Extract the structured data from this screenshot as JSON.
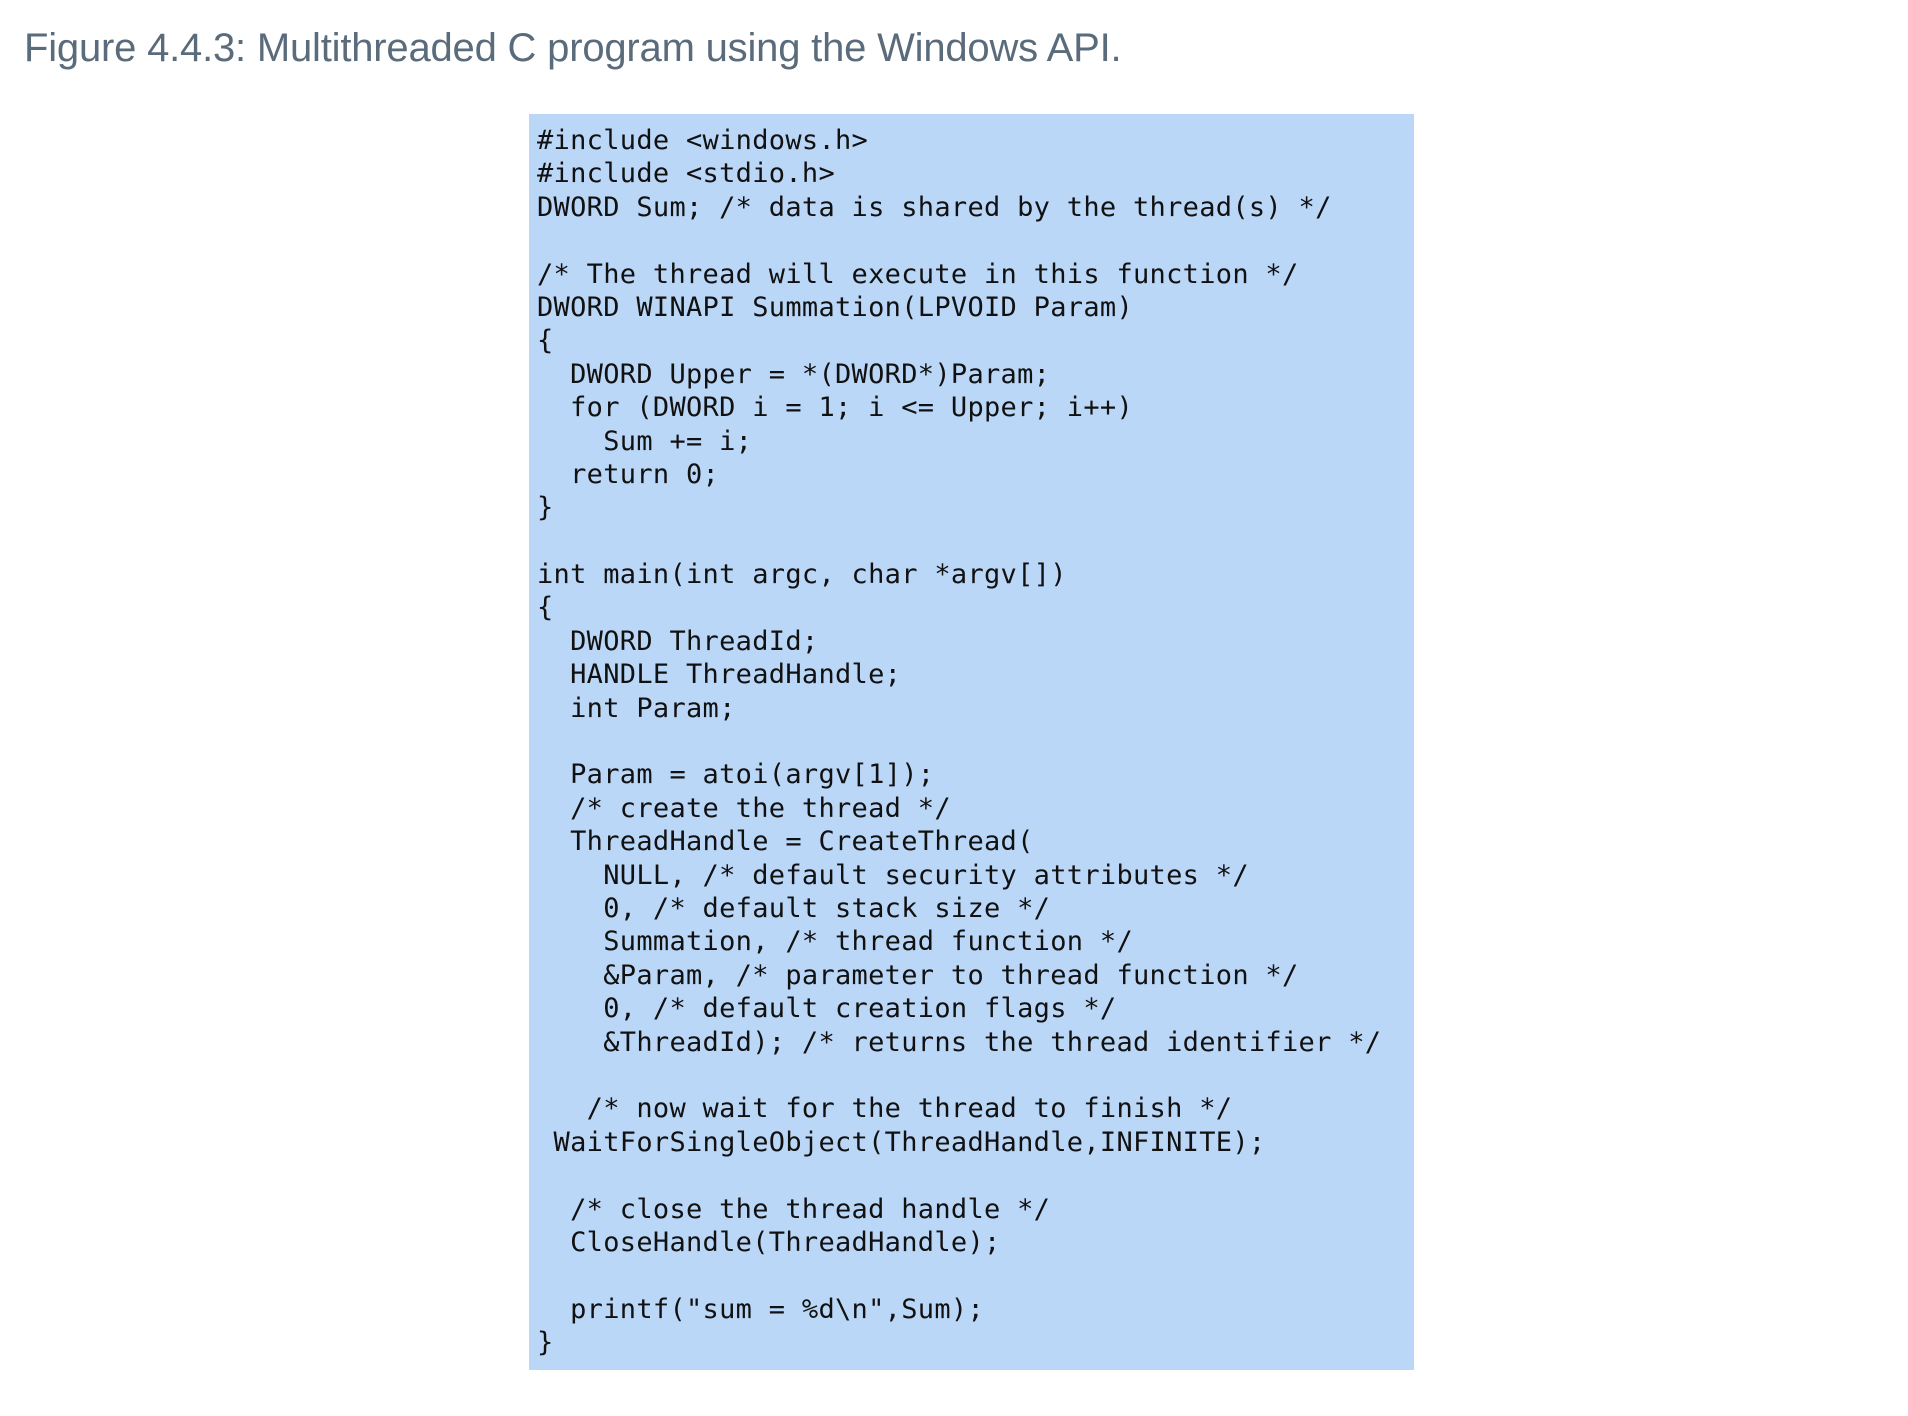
{
  "figure": {
    "caption": "Figure 4.4.3: Multithreaded C program using the Windows API."
  },
  "code": {
    "background_color": "#bbd7f8",
    "lines": [
      "#include <windows.h>",
      "#include <stdio.h>",
      "DWORD Sum; /* data is shared by the thread(s) */",
      "",
      "/* The thread will execute in this function */",
      "DWORD WINAPI Summation(LPVOID Param)",
      "{",
      "  DWORD Upper = *(DWORD*)Param;",
      "  for (DWORD i = 1; i <= Upper; i++)",
      "    Sum += i;",
      "  return 0;",
      "}",
      "",
      "int main(int argc, char *argv[])",
      "{",
      "  DWORD ThreadId;",
      "  HANDLE ThreadHandle;",
      "  int Param;",
      "",
      "  Param = atoi(argv[1]);",
      "  /* create the thread */",
      "  ThreadHandle = CreateThread(",
      "    NULL, /* default security attributes */",
      "    0, /* default stack size */",
      "    Summation, /* thread function */",
      "    &Param, /* parameter to thread function */",
      "    0, /* default creation flags */",
      "    &ThreadId); /* returns the thread identifier */",
      "",
      "   /* now wait for the thread to finish */",
      " WaitForSingleObject(ThreadHandle,INFINITE);",
      "",
      "  /* close the thread handle */",
      "  CloseHandle(ThreadHandle);",
      "",
      "  printf(\"sum = %d\\n\",Sum);",
      "}"
    ]
  }
}
